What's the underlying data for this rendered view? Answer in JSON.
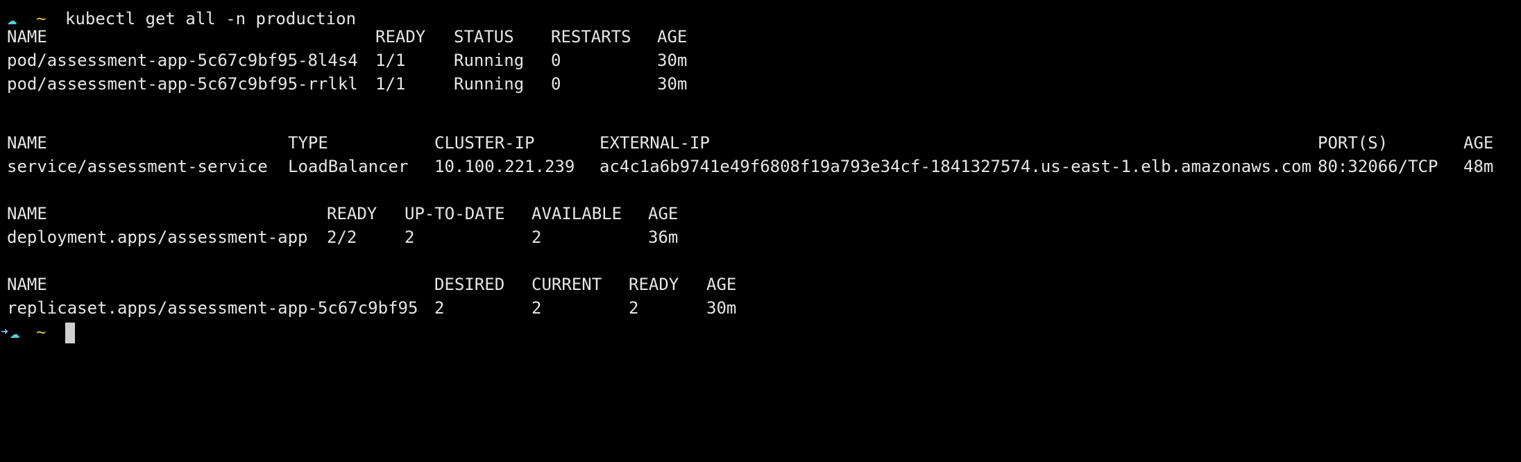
{
  "prompt": {
    "symbol": "☁",
    "arrow": "➜",
    "dir": "~",
    "command": "kubectl get all -n production",
    "symbol_color": "#4dd0e1",
    "dir_color": "#d7c34a"
  },
  "pods": {
    "headers": [
      "NAME",
      "READY",
      "STATUS",
      "RESTARTS",
      "AGE"
    ],
    "rows": [
      [
        "pod/assessment-app-5c67c9bf95-8l4s4",
        "1/1",
        "Running",
        "0",
        "30m"
      ],
      [
        "pod/assessment-app-5c67c9bf95-rrlkl",
        "1/1",
        "Running",
        "0",
        "30m"
      ]
    ]
  },
  "services": {
    "headers": [
      "NAME",
      "TYPE",
      "CLUSTER-IP",
      "EXTERNAL-IP",
      "PORT(S)",
      "AGE"
    ],
    "rows": [
      [
        "service/assessment-service",
        "LoadBalancer",
        "10.100.221.239",
        "ac4c1a6b9741e49f6808f19a793e34cf-1841327574.us-east-1.elb.amazonaws.com",
        "80:32066/TCP",
        "48m"
      ]
    ]
  },
  "deployments": {
    "headers": [
      "NAME",
      "READY",
      "UP-TO-DATE",
      "AVAILABLE",
      "AGE"
    ],
    "rows": [
      [
        "deployment.apps/assessment-app",
        "2/2",
        "2",
        "2",
        "36m"
      ]
    ]
  },
  "replicasets": {
    "headers": [
      "NAME",
      "DESIRED",
      "CURRENT",
      "READY",
      "AGE"
    ],
    "rows": [
      [
        "replicaset.apps/assessment-app-5c67c9bf95",
        "2",
        "2",
        "2",
        "30m"
      ]
    ]
  },
  "final_prompt": {
    "symbol": "☁",
    "arrow": "➜",
    "dir": "~"
  }
}
